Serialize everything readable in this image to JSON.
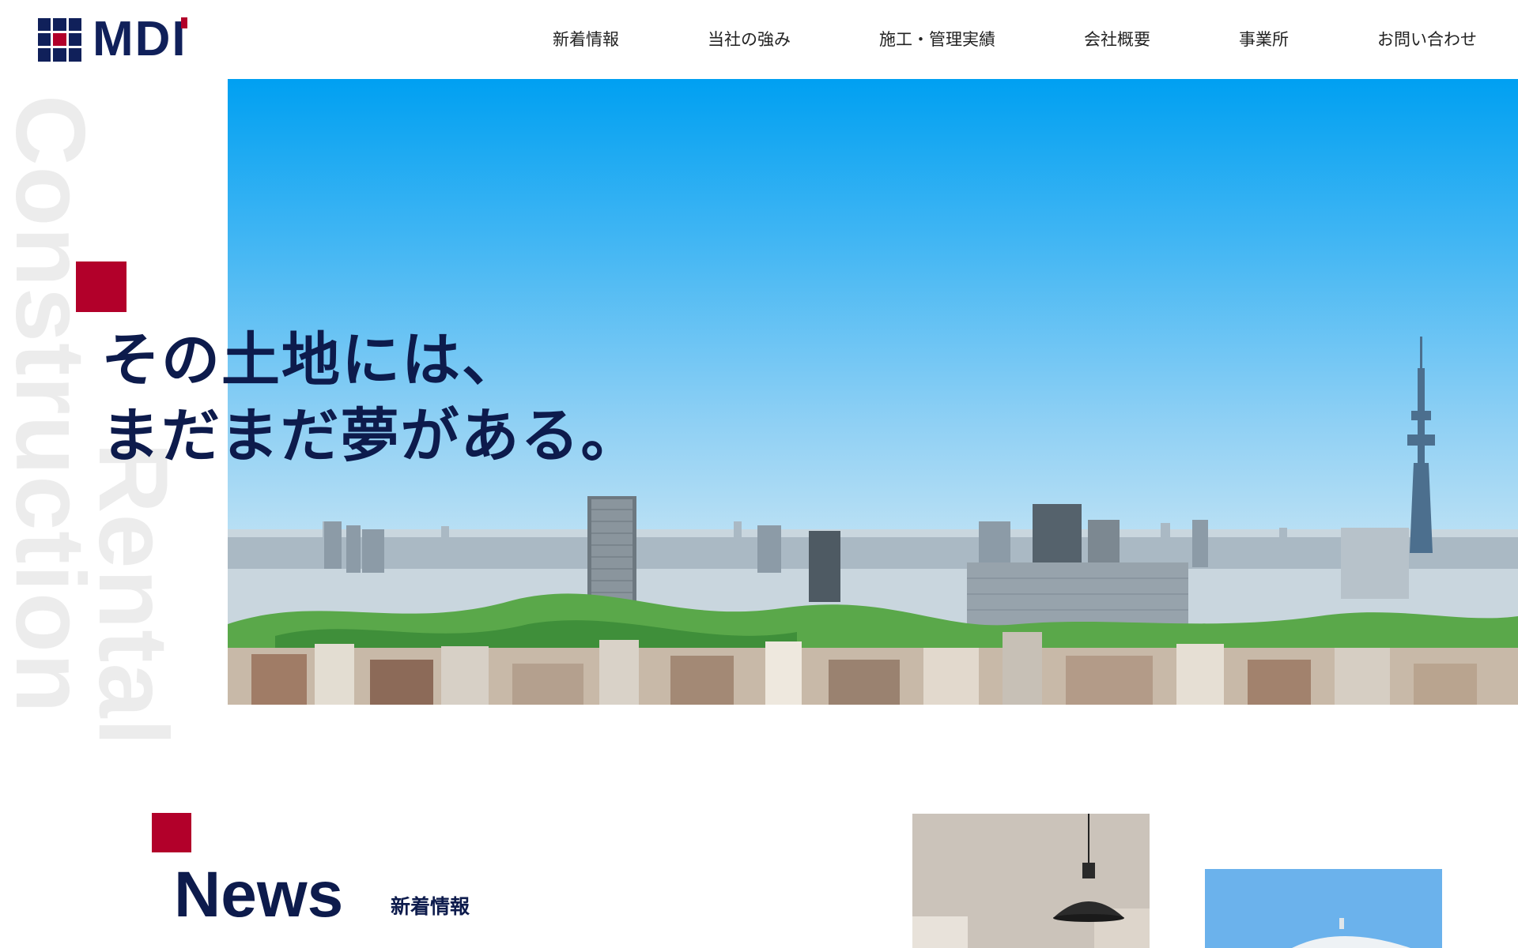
{
  "header": {
    "logo_text": "MDI",
    "nav": [
      {
        "label": "新着情報"
      },
      {
        "label": "当社の強み"
      },
      {
        "label": "施工・管理実績"
      },
      {
        "label": "会社概要"
      },
      {
        "label": "事業所"
      },
      {
        "label": "お問い合わせ"
      }
    ]
  },
  "watermark": {
    "line1": "Construction",
    "line2": "Rental"
  },
  "hero": {
    "catch_line1": "その土地には、",
    "catch_line2": "まだまだ夢がある。",
    "image_alt": "Tokyo city skyline with tower"
  },
  "news": {
    "title": "News",
    "subtitle": "新着情報"
  },
  "colors": {
    "navy": "#0d1b4c",
    "brand_red": "#b2002a",
    "sky_top": "#00a0f2"
  }
}
